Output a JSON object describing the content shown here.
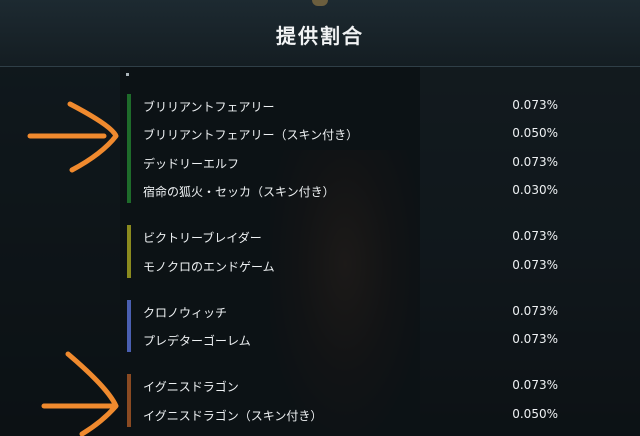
{
  "dialog": {
    "title": "提供割合"
  },
  "groups": [
    {
      "color": "#1e6b2a",
      "items": [
        {
          "name": "ブリリアントフェアリー",
          "rate": "0.073%"
        },
        {
          "name": "ブリリアントフェアリー（スキン付き）",
          "rate": "0.050%"
        },
        {
          "name": "デッドリーエルフ",
          "rate": "0.073%"
        },
        {
          "name": "宿命の狐火・セッカ（スキン付き）",
          "rate": "0.030%"
        }
      ]
    },
    {
      "color": "#8a8a1e",
      "items": [
        {
          "name": "ビクトリーブレイダー",
          "rate": "0.073%"
        },
        {
          "name": "モノクロのエンドゲーム",
          "rate": "0.073%"
        }
      ]
    },
    {
      "color": "#4a5fb0",
      "items": [
        {
          "name": "クロノウィッチ",
          "rate": "0.073%"
        },
        {
          "name": "プレデターゴーレム",
          "rate": "0.073%"
        }
      ]
    },
    {
      "color": "#8a4a22",
      "items": [
        {
          "name": "イグニスドラゴン",
          "rate": "0.073%"
        },
        {
          "name": "イグニスドラゴン（スキン付き）",
          "rate": "0.050%"
        }
      ]
    }
  ],
  "annotation_color": "#f08a2e"
}
